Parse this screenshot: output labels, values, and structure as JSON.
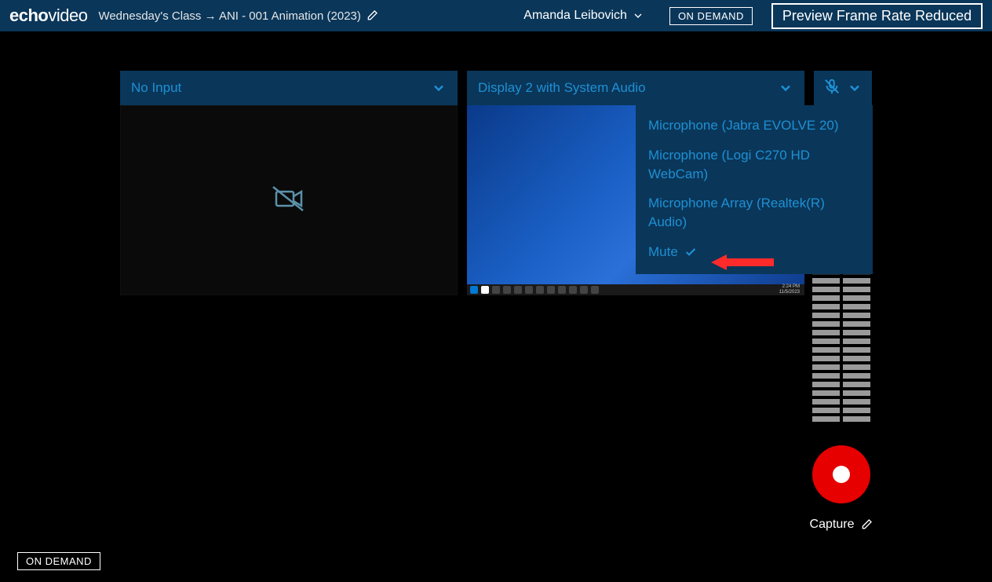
{
  "header": {
    "logo_bold": "echo",
    "logo_thin": "video",
    "breadcrumb": "Wednesday's Class → ANI - 001 Animation (2023)",
    "user": "Amanda Leibovich",
    "on_demand": "ON DEMAND",
    "preview": "Preview Frame Rate Reduced"
  },
  "panels": {
    "left": {
      "title": "No Input"
    },
    "right": {
      "title": "Display 2 with System Audio"
    }
  },
  "taskbar": {
    "time": "2:24 PM",
    "date": "11/5/2023"
  },
  "audio_menu": {
    "opt1": "Microphone (Jabra EVOLVE 20)",
    "opt2": "Microphone (Logi C270 HD WebCam)",
    "opt3": "Microphone Array (Realtek(R) Audio)",
    "opt4": "Mute"
  },
  "capture": {
    "label": "Capture"
  },
  "footer": {
    "on_demand": "ON DEMAND"
  }
}
